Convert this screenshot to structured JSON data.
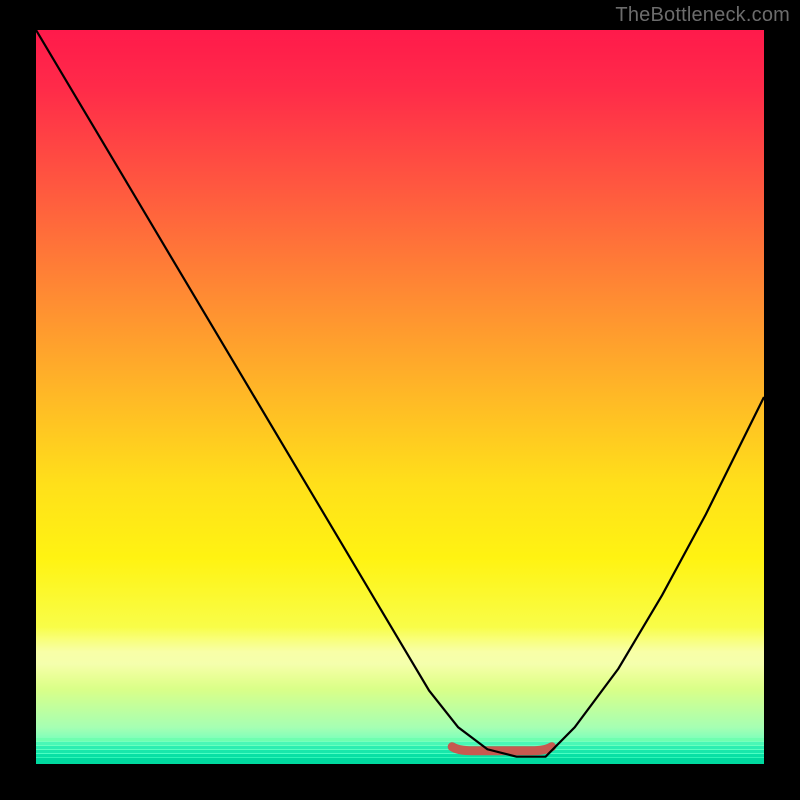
{
  "watermark": "TheBottleneck.com",
  "colors": {
    "background": "#000000",
    "watermark": "#6c6c6c",
    "curve": "#000000",
    "bottom_segment": "#c75a50",
    "gradient_top": "#ff1a4b",
    "gradient_bottom": "#00e6a3"
  },
  "chart_data": {
    "type": "line",
    "title": "",
    "xlabel": "",
    "ylabel": "",
    "xlim": [
      0,
      100
    ],
    "ylim": [
      0,
      100
    ],
    "note": "Axes unlabeled in image; x normalized 0–100 across plot width, y normalized 0–100 top-to-bottom (0 = top). Curve estimated from pixels.",
    "series": [
      {
        "name": "curve",
        "x": [
          0,
          6,
          12,
          18,
          24,
          30,
          36,
          42,
          48,
          54,
          58,
          62,
          66,
          68,
          70,
          74,
          80,
          86,
          92,
          100
        ],
        "y": [
          0,
          10,
          20,
          30,
          40,
          50,
          60,
          70,
          80,
          90,
          95,
          98,
          99,
          99,
          99,
          95,
          87,
          77,
          66,
          50
        ]
      },
      {
        "name": "bottom-flat-segment",
        "x": [
          58,
          70
        ],
        "y": [
          99,
          99
        ]
      }
    ],
    "background_gradient_stops": [
      {
        "pos": 0.0,
        "color": "#ff1a4b"
      },
      {
        "pos": 0.22,
        "color": "#ff5a3f"
      },
      {
        "pos": 0.5,
        "color": "#ffb926"
      },
      {
        "pos": 0.72,
        "color": "#fff312"
      },
      {
        "pos": 0.9,
        "color": "#d8ff8a"
      },
      {
        "pos": 1.0,
        "color": "#00e6a3"
      }
    ]
  }
}
